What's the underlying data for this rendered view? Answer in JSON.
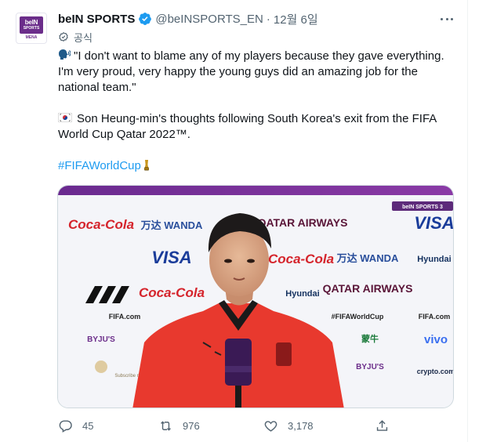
{
  "tweet": {
    "author_name": "beIN SPORTS",
    "handle": "@beINSPORTS_EN",
    "separator": "·",
    "time": "12월 6일",
    "official_label": "공식",
    "avatar": {
      "logo_top": "beIN",
      "logo_mid": "SPORTS",
      "logo_sub": "MENA"
    },
    "text": {
      "quote": "\"I don't want to blame any of my players because they gave everything. I'm very proud, very happy the young guys did an amazing job for the national team.\"",
      "summary": "Son Heung-min's thoughts following South Korea's exit from the FIFA World Cup Qatar 2022™.",
      "hashtag": "#FIFAWorldCup"
    },
    "icons": {
      "speaking": "speaking-head-emoji",
      "flag": "south-korea-flag-emoji",
      "trophy": "trophy-emoji"
    },
    "stats": {
      "replies": "45",
      "retweets": "976",
      "likes": "3,178"
    }
  },
  "media": {
    "corner_tag": "beIN SPORTS 3",
    "backdrop_logos": [
      "Coca-Cola",
      "万达 WANDA",
      "QATAR AIRWAYS",
      "VISA",
      "Hyundai",
      "FIFA.com",
      "#FIFAWorldCup",
      "BYJU'S",
      "蒙牛",
      "vivo",
      "crypto.com"
    ],
    "subscribe_text": "Subscribe now"
  },
  "colors": {
    "accent": "#1d9bf0",
    "brand_purple": "#6b2d8a",
    "jersey_red": "#e8392e",
    "text_secondary": "#536471"
  }
}
